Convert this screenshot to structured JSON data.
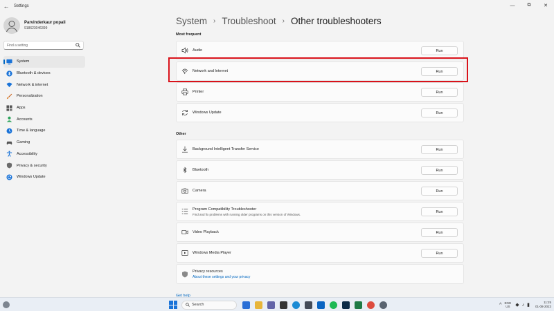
{
  "window": {
    "title": "Settings",
    "back_icon": "back-arrow-icon"
  },
  "profile": {
    "name": "Parvinderkaur popali",
    "sub": "918623046399"
  },
  "search": {
    "placeholder": "Find a setting"
  },
  "sidebar": {
    "items": [
      {
        "label": "System",
        "icon": "system-icon",
        "color": "#1a73d8",
        "active": true
      },
      {
        "label": "Bluetooth & devices",
        "icon": "bluetooth-icon",
        "color": "#1a73d8"
      },
      {
        "label": "Network & internet",
        "icon": "wifi-icon",
        "color": "#1a73d8"
      },
      {
        "label": "Personalization",
        "icon": "brush-icon",
        "color": "#c75b12"
      },
      {
        "label": "Apps",
        "icon": "apps-icon",
        "color": "#555555"
      },
      {
        "label": "Accounts",
        "icon": "accounts-icon",
        "color": "#2aa45a"
      },
      {
        "label": "Time & language",
        "icon": "globe-clock-icon",
        "color": "#1a73d8"
      },
      {
        "label": "Gaming",
        "icon": "gamepad-icon",
        "color": "#555555"
      },
      {
        "label": "Accessibility",
        "icon": "accessibility-icon",
        "color": "#1a73d8"
      },
      {
        "label": "Privacy & security",
        "icon": "shield-icon",
        "color": "#6b6b6b"
      },
      {
        "label": "Windows Update",
        "icon": "update-icon",
        "color": "#1a73d8"
      }
    ]
  },
  "breadcrumb": {
    "items": [
      "System",
      "Troubleshoot"
    ],
    "current": "Other troubleshooters",
    "separator": "›"
  },
  "sections": {
    "most_frequent": "Most frequent",
    "other": "Other"
  },
  "most_frequent": [
    {
      "label": "Audio",
      "icon": "speaker-icon",
      "button": "Run"
    },
    {
      "label": "Network and Internet",
      "icon": "network-icon",
      "button": "Run",
      "highlighted": true
    },
    {
      "label": "Printer",
      "icon": "printer-icon",
      "button": "Run"
    },
    {
      "label": "Windows Update",
      "icon": "refresh-icon",
      "button": "Run"
    }
  ],
  "other": [
    {
      "label": "Background Intelligent Transfer Service",
      "icon": "download-icon",
      "button": "Run"
    },
    {
      "label": "Bluetooth",
      "icon": "bluetooth-icon",
      "button": "Run"
    },
    {
      "label": "Camera",
      "icon": "camera-icon",
      "button": "Run"
    },
    {
      "label": "Program Compatibility Troubleshooter",
      "desc": "Find and fix problems with running older programs on this version of Windows.",
      "icon": "list-icon",
      "button": "Run"
    },
    {
      "label": "Video Playback",
      "icon": "video-icon",
      "button": "Run"
    },
    {
      "label": "Windows Media Player",
      "icon": "media-player-icon",
      "button": "Run"
    }
  ],
  "privacy": {
    "title": "Privacy resources",
    "link": "About these settings and your privacy",
    "icon": "shield-icon"
  },
  "get_help": "Get help",
  "taskbar": {
    "search_label": "Search",
    "apps": [
      {
        "icon": "edge-copilot-icon",
        "color": "#2a6fd6"
      },
      {
        "icon": "file-explorer-icon",
        "color": "#e7b53a"
      },
      {
        "icon": "teams-icon",
        "color": "#6264a7"
      },
      {
        "icon": "task-view-icon",
        "color": "#333333"
      },
      {
        "icon": "edge-icon",
        "color": "#1b8ad4"
      },
      {
        "icon": "store-icon",
        "color": "#444b57"
      },
      {
        "icon": "mail-icon",
        "color": "#0a64c2"
      },
      {
        "icon": "spotify-icon",
        "color": "#1db954"
      },
      {
        "icon": "photoshop-icon",
        "color": "#0b2a45"
      },
      {
        "icon": "excel-icon",
        "color": "#1f7a45"
      },
      {
        "icon": "chrome-icon",
        "color": "#dd4b3e"
      },
      {
        "icon": "settings-icon",
        "color": "#5a6470"
      }
    ],
    "lang_top": "ENG",
    "lang_bottom": "US",
    "time": "11:25",
    "date": "01-08-2023"
  }
}
